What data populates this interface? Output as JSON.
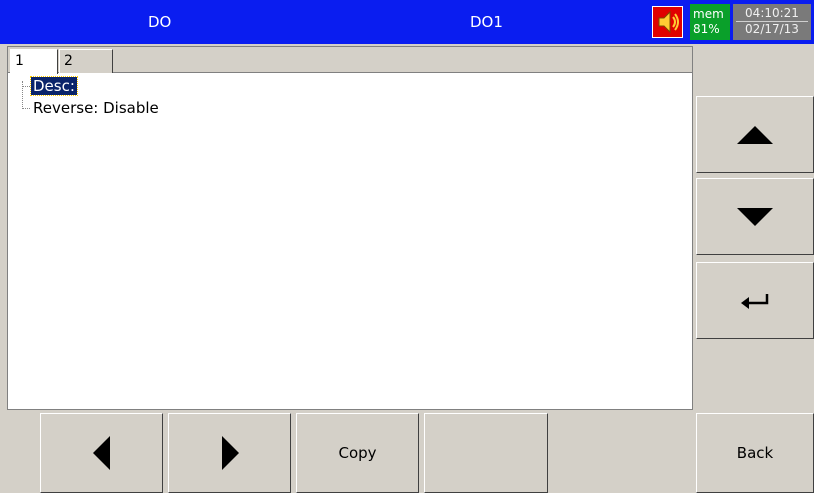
{
  "header": {
    "left_title": "DO",
    "center_title": "DO1",
    "mem_label": "mem",
    "mem_value": "81%",
    "time": "04:10:21",
    "date": "02/17/13"
  },
  "tabs": [
    {
      "label": "1",
      "selected": true
    },
    {
      "label": "2",
      "selected": false
    }
  ],
  "tree": {
    "items": [
      {
        "label": "Desc:",
        "selected": true
      },
      {
        "label": "Reverse: Disable",
        "selected": false
      }
    ]
  },
  "side_buttons": {
    "up_icon": "up-arrow-icon",
    "down_icon": "down-arrow-icon",
    "enter_icon": "enter-icon"
  },
  "bottom_buttons": {
    "prev_icon": "left-arrow-icon",
    "next_icon": "right-arrow-icon",
    "copy_label": "Copy",
    "blank_label": "",
    "back_label": "Back"
  },
  "colors": {
    "header_bg": "#0a1df0",
    "speaker_bg": "#e00000",
    "mem_bg": "#0aa02a",
    "clock_bg": "#7a7a7a",
    "selection_bg": "#0a246a",
    "button_face": "#d4d0c8"
  }
}
